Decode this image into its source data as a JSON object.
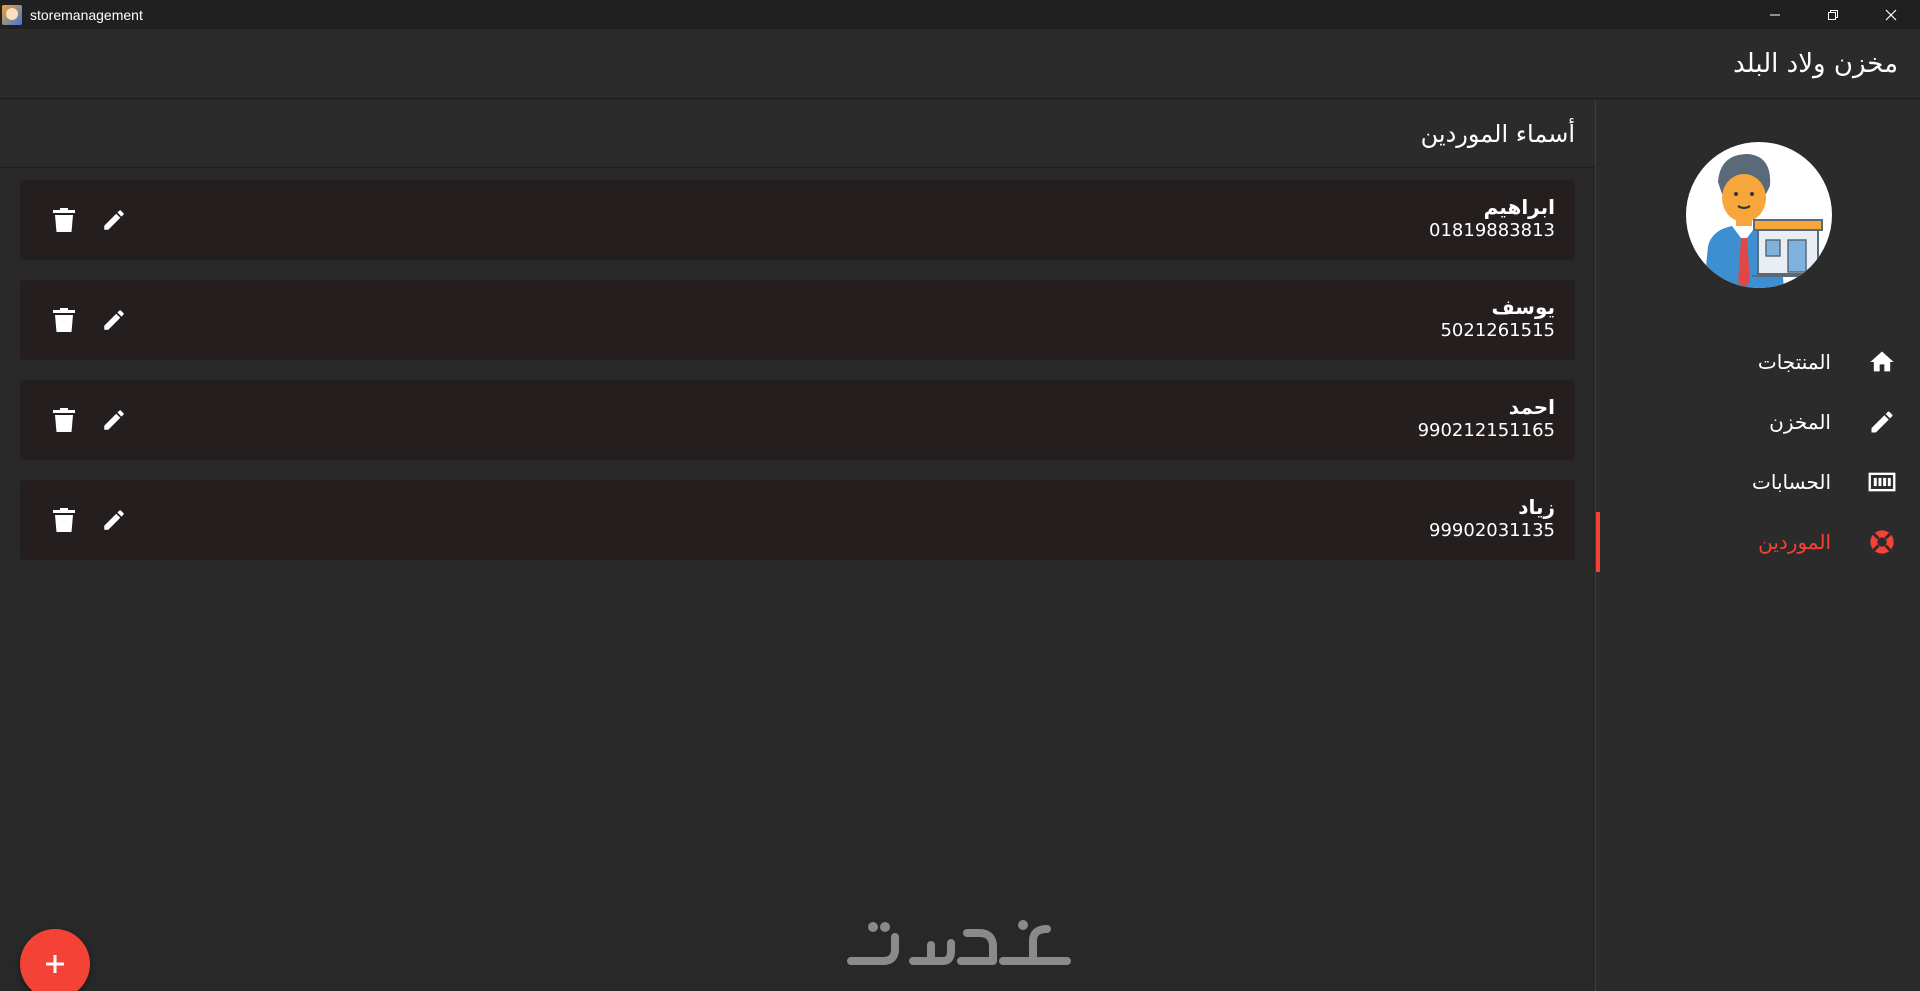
{
  "window": {
    "title": "storemanagement"
  },
  "appbar": {
    "title": "مخزن ولاد البلد"
  },
  "main": {
    "section_title": "أسماء الموردين",
    "suppliers": [
      {
        "name": "ابراهيم",
        "phone": "01819883813"
      },
      {
        "name": "يوسف",
        "phone": "5021261515"
      },
      {
        "name": "احمد",
        "phone": "990212151165"
      },
      {
        "name": "زياد",
        "phone": "99902031135"
      }
    ]
  },
  "sidebar": {
    "items": [
      {
        "label": "المنتجات",
        "icon": "home-icon"
      },
      {
        "label": "المخزن",
        "icon": "pencil-icon"
      },
      {
        "label": "الحسابات",
        "icon": "money-icon"
      },
      {
        "label": "الموردين",
        "icon": "lifebuoy-icon",
        "active": true
      }
    ]
  },
  "colors": {
    "accent": "#f44336",
    "background": "#282828",
    "card": "#241e1e"
  },
  "fab": {
    "icon": "plus-icon"
  },
  "watermark": {
    "text": "خمسات"
  }
}
